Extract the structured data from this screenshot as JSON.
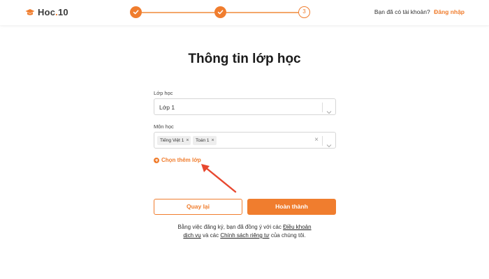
{
  "header": {
    "logo_text": "Hoc",
    "logo_suffix": "10",
    "logo_icon": "graduation-cap-icon",
    "account_question": "Bạn đã có tài khoản?",
    "login_label": "Đăng nhập"
  },
  "stepper": {
    "steps": [
      {
        "state": "done",
        "icon": "check-icon"
      },
      {
        "state": "done",
        "icon": "check-icon"
      },
      {
        "state": "current",
        "label": "3"
      }
    ]
  },
  "title": "Thông tin lớp học",
  "form": {
    "class_label": "Lớp học",
    "class_value": "Lớp 1",
    "subject_label": "Môn học",
    "subject_tags": [
      "Tiếng Việt 1",
      "Toán 1"
    ],
    "add_more_label": "Chọn thêm lớp"
  },
  "buttons": {
    "back_label": "Quay lại",
    "done_label": "Hoàn thành"
  },
  "terms": {
    "text1": "Bằng việc đăng ký, bạn đã đồng ý với các",
    "link1a": "Điều khoản",
    "link1b": "dịch vụ",
    "text2": "và các",
    "link2": "Chính sách riêng tư",
    "text3": "của chúng tôi."
  },
  "colors": {
    "accent": "#f07d2e",
    "annotation_arrow": "#e8482f"
  }
}
